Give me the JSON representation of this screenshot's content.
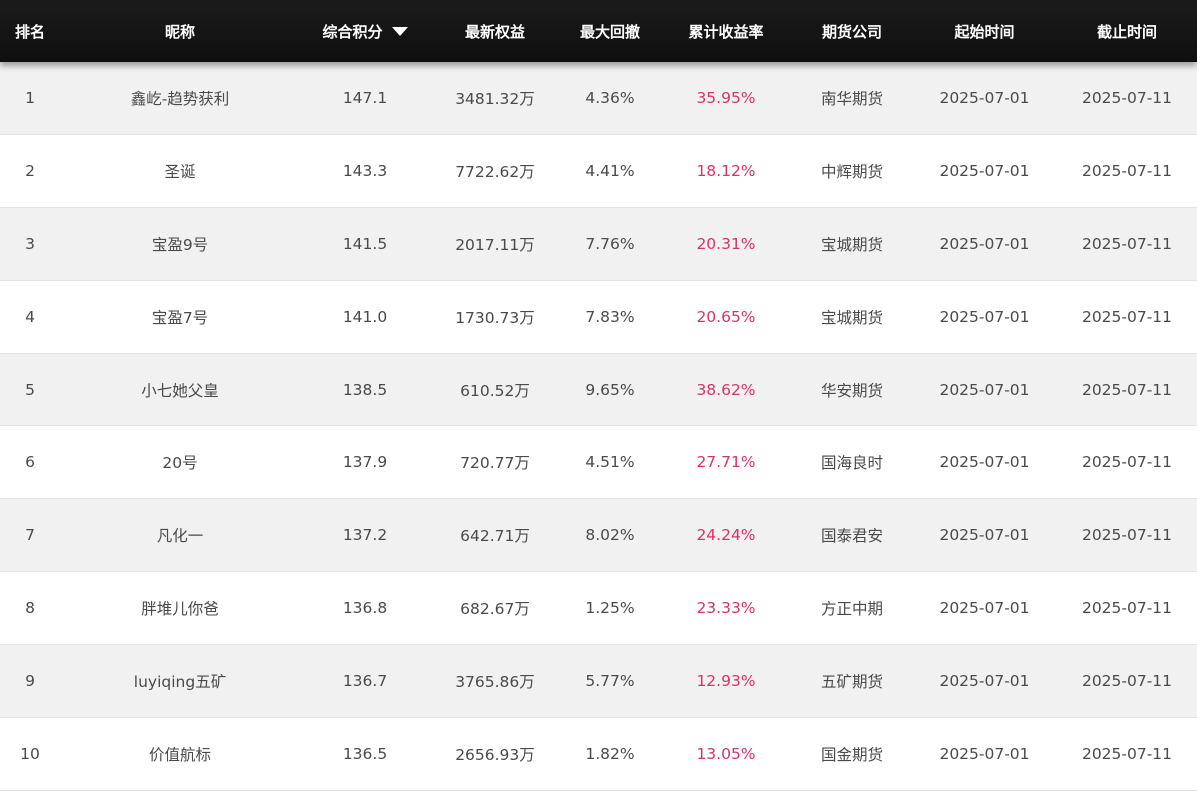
{
  "header": {
    "rank": "排名",
    "nickname": "昵称",
    "score": "综合积分",
    "equity": "最新权益",
    "drawdown": "最大回撤",
    "return_rate": "累计收益率",
    "company": "期货公司",
    "start": "起始时间",
    "end": "截止时间",
    "sort_icon": "caret-down-icon"
  },
  "colors": {
    "header_bg": "#141414",
    "return_rate": "#d6336c",
    "row_alt": "#f1f1f1"
  },
  "rows": [
    {
      "rank": "1",
      "nickname": "鑫屹-趋势获利",
      "score": "147.1",
      "equity": "3481.32万",
      "drawdown": "4.36%",
      "return_rate": "35.95%",
      "company": "南华期货",
      "start": "2025-07-01",
      "end": "2025-07-11"
    },
    {
      "rank": "2",
      "nickname": "圣诞",
      "score": "143.3",
      "equity": "7722.62万",
      "drawdown": "4.41%",
      "return_rate": "18.12%",
      "company": "中辉期货",
      "start": "2025-07-01",
      "end": "2025-07-11"
    },
    {
      "rank": "3",
      "nickname": "宝盈9号",
      "score": "141.5",
      "equity": "2017.11万",
      "drawdown": "7.76%",
      "return_rate": "20.31%",
      "company": "宝城期货",
      "start": "2025-07-01",
      "end": "2025-07-11"
    },
    {
      "rank": "4",
      "nickname": "宝盈7号",
      "score": "141.0",
      "equity": "1730.73万",
      "drawdown": "7.83%",
      "return_rate": "20.65%",
      "company": "宝城期货",
      "start": "2025-07-01",
      "end": "2025-07-11"
    },
    {
      "rank": "5",
      "nickname": "小七她父皇",
      "score": "138.5",
      "equity": "610.52万",
      "drawdown": "9.65%",
      "return_rate": "38.62%",
      "company": "华安期货",
      "start": "2025-07-01",
      "end": "2025-07-11"
    },
    {
      "rank": "6",
      "nickname": "20号",
      "score": "137.9",
      "equity": "720.77万",
      "drawdown": "4.51%",
      "return_rate": "27.71%",
      "company": "国海良时",
      "start": "2025-07-01",
      "end": "2025-07-11"
    },
    {
      "rank": "7",
      "nickname": "凡化一",
      "score": "137.2",
      "equity": "642.71万",
      "drawdown": "8.02%",
      "return_rate": "24.24%",
      "company": "国泰君安",
      "start": "2025-07-01",
      "end": "2025-07-11"
    },
    {
      "rank": "8",
      "nickname": "胖堆儿你爸",
      "score": "136.8",
      "equity": "682.67万",
      "drawdown": "1.25%",
      "return_rate": "23.33%",
      "company": "方正中期",
      "start": "2025-07-01",
      "end": "2025-07-11"
    },
    {
      "rank": "9",
      "nickname": "luyiqing五矿",
      "score": "136.7",
      "equity": "3765.86万",
      "drawdown": "5.77%",
      "return_rate": "12.93%",
      "company": "五矿期货",
      "start": "2025-07-01",
      "end": "2025-07-11"
    },
    {
      "rank": "10",
      "nickname": "价值航标",
      "score": "136.5",
      "equity": "2656.93万",
      "drawdown": "1.82%",
      "return_rate": "13.05%",
      "company": "国金期货",
      "start": "2025-07-01",
      "end": "2025-07-11"
    }
  ]
}
